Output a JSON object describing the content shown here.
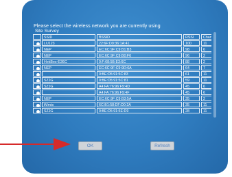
{
  "dialog": {
    "title": "Please select the wireless network you are currently using",
    "survey_label": "Site Survey"
  },
  "table": {
    "columns": [
      "",
      "SSID",
      "BSSID",
      "RSSI",
      "Channel"
    ],
    "rows": [
      {
        "ssid": "LU123",
        "bssid": "22:6F:D9:36:1A:41",
        "rssi": "100",
        "channel": "11"
      },
      {
        "ssid": "NEP",
        "bssid": "EC:6C:9F:C9:B1:B3",
        "rssi": "98",
        "channel": "6"
      },
      {
        "ssid": "NEP",
        "bssid": "EC:6C:9F:C9:B0:F6",
        "rssi": "96",
        "channel": "2"
      },
      {
        "ssid": "HekBex-E36C",
        "bssid": "0:F:68:5B:E3:6C",
        "rssi": "88",
        "channel": "2"
      },
      {
        "ssid": "NEP",
        "bssid": "EC:6C:9F:C9:9D:6A",
        "rssi": "64",
        "channel": "7"
      },
      {
        "ssid": "",
        "bssid": "0:BE:D5:91:5C:83",
        "rssi": "61",
        "channel": "11"
      },
      {
        "ssid": "SZJG",
        "bssid": "0:BE:D5:91:5C:81",
        "rssi": "59",
        "channel": "11"
      },
      {
        "ssid": "SZJG",
        "bssid": "A4:FA:76:96:F9:4D",
        "rssi": "45",
        "channel": "6"
      },
      {
        "ssid": "",
        "bssid": "A4:FA:76:96:F9:4F",
        "rssi": "45",
        "channel": "6"
      },
      {
        "ssid": "NEP",
        "bssid": "EC:6C:9F:C9:B3:5A",
        "rssi": "35",
        "channel": "2"
      },
      {
        "ssid": "iMmts",
        "bssid": "6C:B1:58:DF:D0:2A",
        "rssi": "35",
        "channel": "11"
      },
      {
        "ssid": "SZJG",
        "bssid": "0:BE:D5:91:5E:D9",
        "rssi": "28",
        "channel": "11"
      }
    ]
  },
  "buttons": {
    "ok": "OK",
    "refresh": "Refresh"
  },
  "colors": {
    "panel": "#2f7cbf",
    "arrow": "#d62a2a",
    "button_text": "#4f7fbf"
  }
}
